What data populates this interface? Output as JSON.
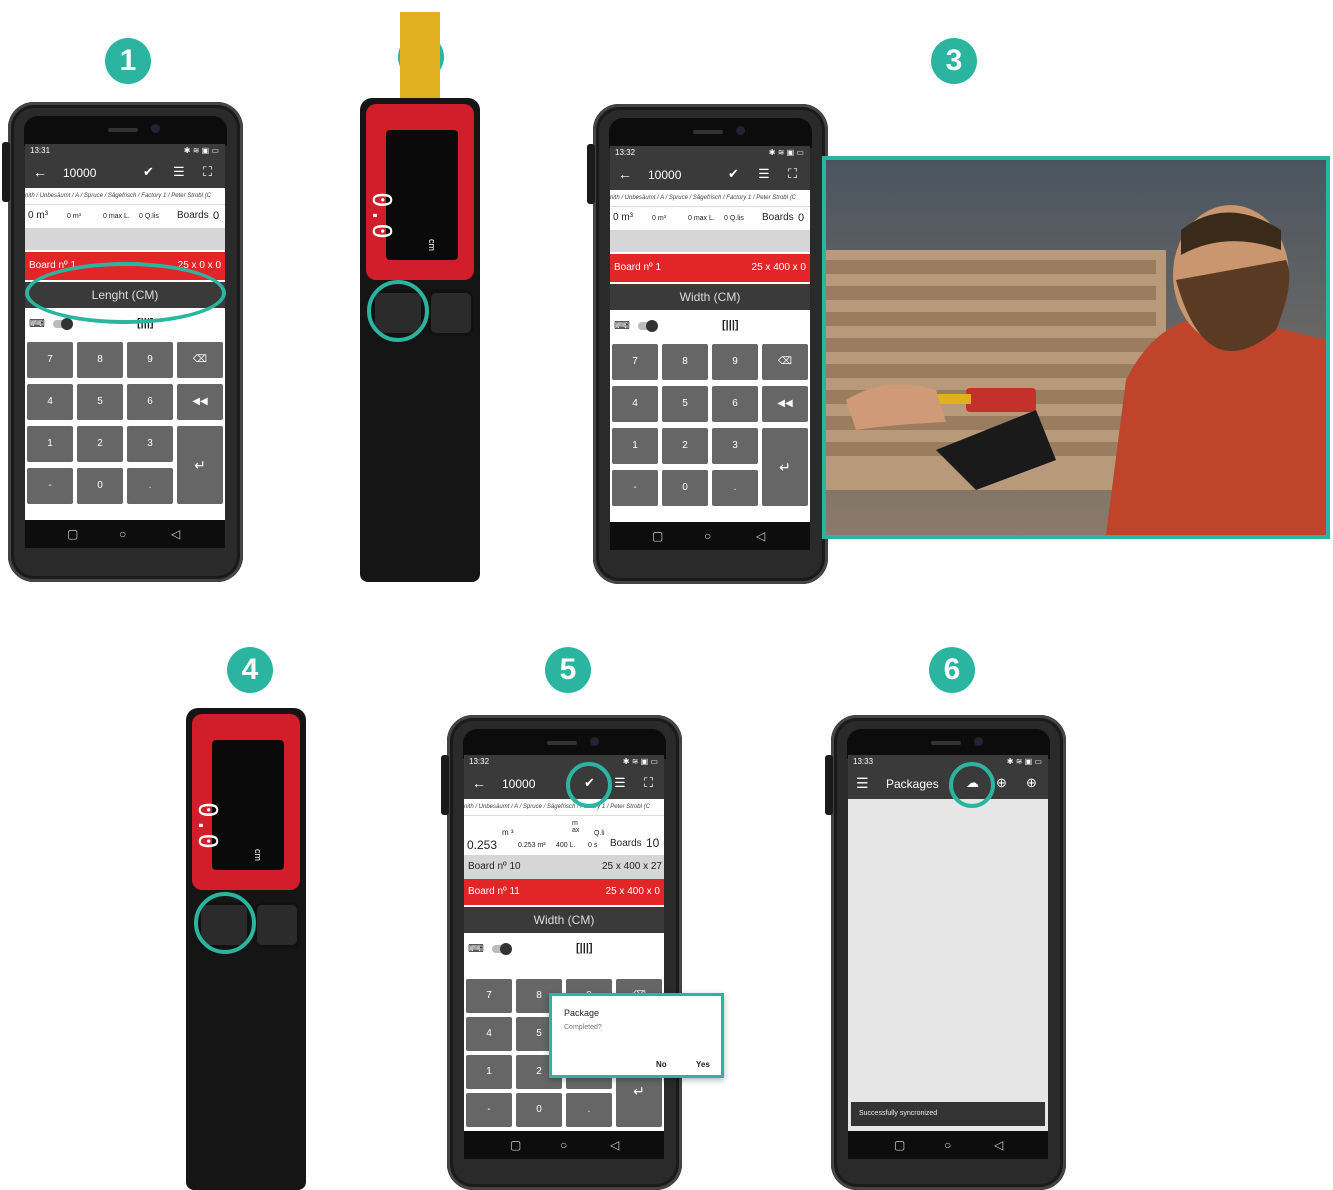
{
  "steps": [
    "1",
    "2",
    "3",
    "4",
    "5",
    "6"
  ],
  "phone1": {
    "time": "13:31",
    "title": "10000",
    "breadcrumb": "nith / Unbesäumt / A / Spruce / Sägefrisch / Factory 1 / Peter Strobl (C",
    "stats": {
      "vol": "0 m³",
      "vol2": "0 m³",
      "maxl": "0 max L.",
      "qlis": "0 Q.lis",
      "boards_label": "Boards",
      "boards": "0"
    },
    "board_label": "Board nº 1",
    "board_dims": "25 x 0 x 0",
    "field": "Lenght (CM)"
  },
  "phone3": {
    "time": "13:32",
    "title": "10000",
    "breadcrumb": "nith / Unbesäumt / A / Spruce / Sägefrisch / Factory 1 / Peter Strobl (C",
    "stats": {
      "vol": "0 m³",
      "vol2": "0 m³",
      "maxl": "0 max L.",
      "qlis": "0 Q.lis",
      "boards_label": "Boards",
      "boards": "0"
    },
    "board_label": "Board nº 1",
    "board_dims": "25 x 400 x 0",
    "field": "Width (CM)"
  },
  "phone5": {
    "time": "13:32",
    "title": "10000",
    "breadcrumb": "nith / Unbesäumt / A / Spruce / Sägefrisch / Factory 1 / Peter Strobl (C",
    "stats": {
      "vol": "0.253",
      "vol_unit": "m ³",
      "vol2": "0.253 m³",
      "maxl_label": "m ax",
      "maxl": "400 L.",
      "qlis_label": "Q.li",
      "qlis": "0 s",
      "boards_label": "Boards",
      "boards": "10"
    },
    "prev_board_label": "Board nº 10",
    "prev_board_dims": "25 x 400 x 27",
    "board_label": "Board nº 11",
    "board_dims": "25 x 400 x 0",
    "field": "Width (CM)",
    "dialog": {
      "title": "Package",
      "message": "Completed?",
      "no": "No",
      "yes": "Yes"
    }
  },
  "phone6": {
    "time": "13:33",
    "title": "Packages",
    "toast": "Successfully syncronized"
  },
  "keypad": [
    "7",
    "8",
    "9",
    "4",
    "5",
    "6",
    "1",
    "2",
    "3",
    "-",
    "0",
    "."
  ],
  "device": {
    "reading": "0.0",
    "unit": "cm"
  },
  "colors": {
    "accent": "#2bb5a0",
    "red": "#e22527",
    "toolbar": "#3a3a3a"
  }
}
